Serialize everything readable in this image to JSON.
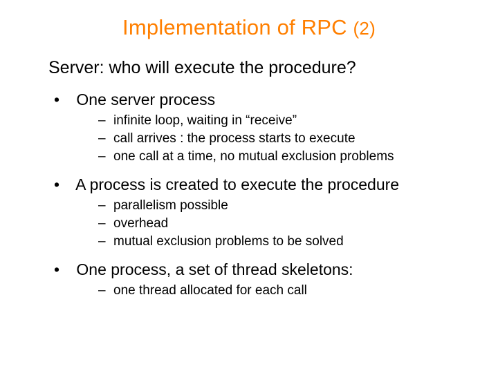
{
  "title_main": "Implementation of RPC ",
  "title_sub": "(2)",
  "lead": "Server: who will execute the procedure?",
  "bullets": [
    {
      "text": "One server process",
      "children": [
        "infinite loop, waiting in “receive”",
        "call arrives : the process starts to execute",
        "one call at a time, no mutual exclusion problems"
      ]
    },
    {
      "text": "A process is created to execute the procedure",
      "children": [
        "parallelism possible",
        "overhead",
        "mutual exclusion problems to be solved"
      ]
    },
    {
      "text": "One process, a set of thread skeletons:",
      "children": [
        "one thread allocated for each call"
      ]
    }
  ]
}
